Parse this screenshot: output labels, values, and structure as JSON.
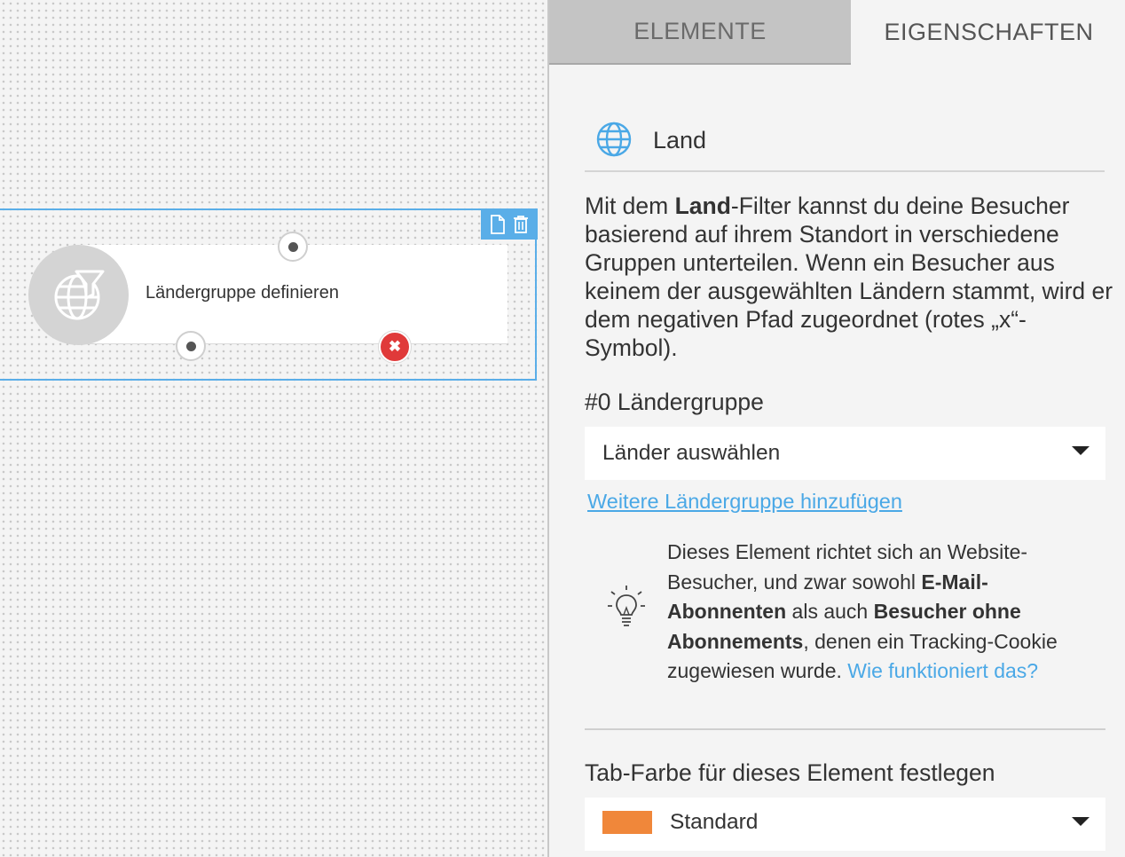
{
  "canvas": {
    "node": {
      "title": "Ländergruppe definieren"
    }
  },
  "tabs": [
    {
      "label": "ELEMENTE",
      "active": false
    },
    {
      "label": "EIGENSCHAFTEN",
      "active": true
    }
  ],
  "properties": {
    "element_name": "Land",
    "description": {
      "prefix": "Mit dem ",
      "bold": "Land",
      "suffix": "-Filter kannst du deine Besucher basierend auf ihrem Standort in verschiedene Gruppen unterteilen. Wenn ein Besucher aus keinem der ausgewählten Ländern stammt, wird er dem negativen Pfad zugeordnet (rotes „x“-Symbol)."
    },
    "group_label": "#0 Ländergruppe",
    "countries_select": {
      "value": "Länder auswählen"
    },
    "add_group_link": "Weitere Ländergruppe hinzufügen",
    "hint": {
      "part1": "Dieses Element richtet sich an Website-Besucher, und zwar sowohl ",
      "bold1": "E-Mail-Abonnenten",
      "part2": " als auch ",
      "bold2": "Besucher ohne Abonnements",
      "part3": ", denen ein Tracking-Cookie zugewiesen wurde. ",
      "link": "Wie funktioniert das?"
    },
    "tab_color_label": "Tab-Farbe für dieses Element festlegen",
    "tab_color_select": {
      "value": "Standard",
      "swatch": "#f0873a"
    }
  },
  "colors": {
    "accent": "#5aaee8",
    "link": "#4aa8e6",
    "negative": "#e03a3a"
  }
}
